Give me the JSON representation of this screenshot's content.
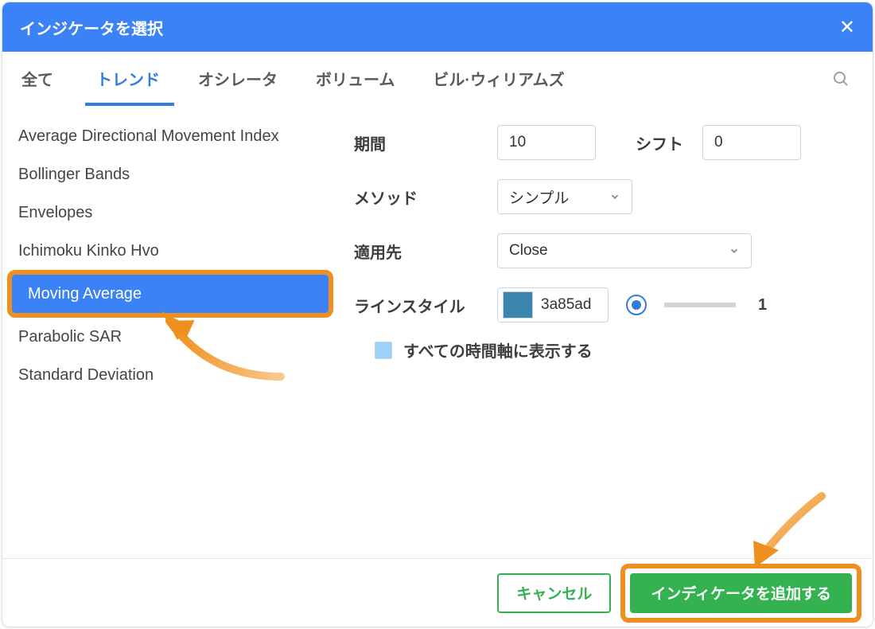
{
  "header": {
    "title": "インジケータを選択"
  },
  "tabs": {
    "items": [
      {
        "label": "全て"
      },
      {
        "label": "トレンド"
      },
      {
        "label": "オシレータ"
      },
      {
        "label": "ボリューム"
      },
      {
        "label": "ビル·ウィリアムズ"
      }
    ],
    "active_index": 1
  },
  "indicator_list": [
    {
      "name": "Average Directional Movement Index"
    },
    {
      "name": "Bollinger Bands"
    },
    {
      "name": "Envelopes"
    },
    {
      "name": "Ichimoku Kinko Hvo"
    },
    {
      "name": "Moving Average",
      "selected": true
    },
    {
      "name": "Parabolic SAR"
    },
    {
      "name": "Standard Deviation"
    }
  ],
  "panel": {
    "period_label": "期間",
    "period_value": "10",
    "shift_label": "シフト",
    "shift_value": "0",
    "method_label": "メソッド",
    "method_value": "シンプル",
    "apply_label": "適用先",
    "apply_value": "Close",
    "line_label": "ラインスタイル",
    "line_color_hex": "3a85ad",
    "line_width": "1",
    "show_all_tf_label": "すべての時間軸に表示する"
  },
  "footer": {
    "cancel": "キャンセル",
    "add": "インディケータを追加する"
  },
  "annotation": {
    "highlight_color": "#ef8f1f"
  }
}
